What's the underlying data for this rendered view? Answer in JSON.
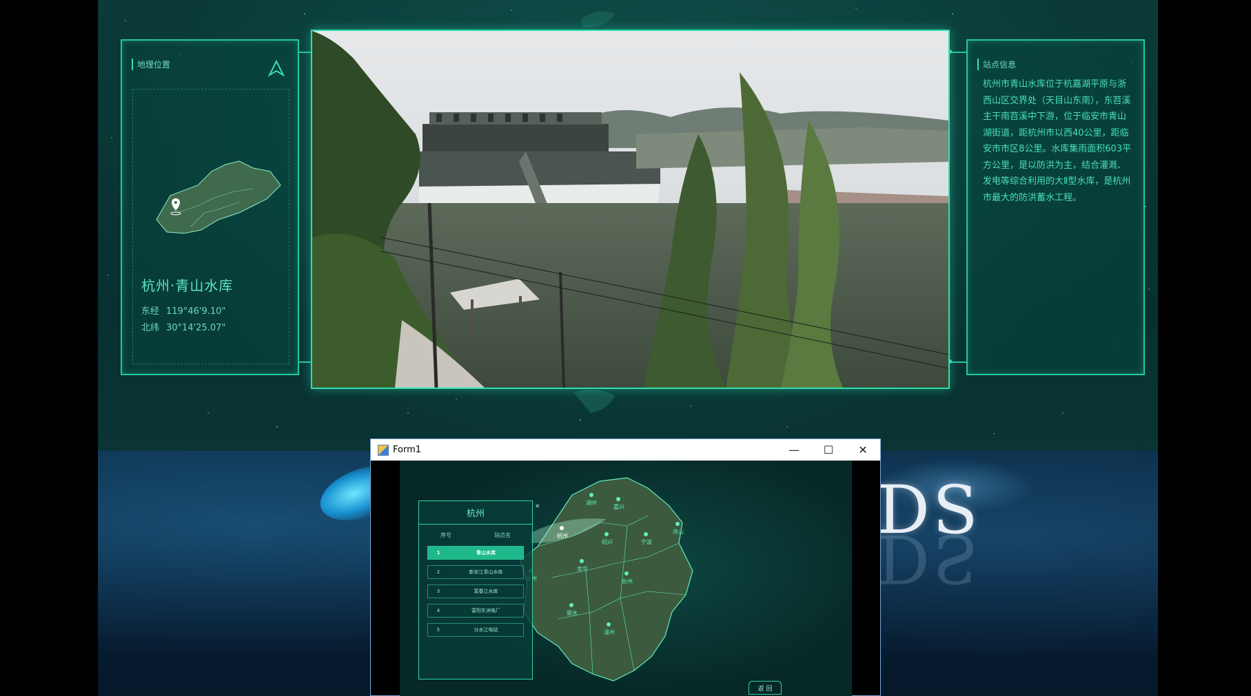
{
  "left_panel": {
    "title": "地理位置",
    "site_name": "杭州·青山水库",
    "lng_label": "东经",
    "lng_value": "119°46'9.10\"",
    "lat_label": "北纬",
    "lat_value": "30°14'25.07\""
  },
  "right_panel": {
    "title": "站点信息",
    "description": "杭州市青山水库位于杭嘉湖平原与浙西山区交界处（天目山东南），东苕溪主干南苕溪中下游，位于临安市青山湖街道，距杭州市以西40公里，距临安市市区8公里。水库集雨面积603平方公里，是以防洪为主，结合灌溉、发电等综合利用的大Ⅱ型水库，是杭州市最大的防洪蓄水工程。"
  },
  "background_text": "DS",
  "form_window": {
    "title": "Form1",
    "minimize": "—",
    "maximize": "☐",
    "close": "✕",
    "list": {
      "title": "杭州",
      "columns": [
        "序号",
        "站点名"
      ],
      "close": "✕",
      "rows": [
        {
          "num": "1",
          "name": "青山水库"
        },
        {
          "num": "2",
          "name": "新安江青山水库"
        },
        {
          "num": "3",
          "name": "富春江水库"
        },
        {
          "num": "4",
          "name": "富阳东洲电厂"
        },
        {
          "num": "5",
          "name": "分水江电站"
        }
      ]
    },
    "back_button": "返 回",
    "map_labels": [
      "杭州",
      "湖州",
      "嘉兴",
      "绍兴",
      "宁波",
      "舟山",
      "金华",
      "台州",
      "衢州",
      "丽水",
      "温州"
    ]
  },
  "colors": {
    "accent": "#21c8a0",
    "text_accent": "#48e0b8",
    "active_row": "#1fb88a"
  }
}
